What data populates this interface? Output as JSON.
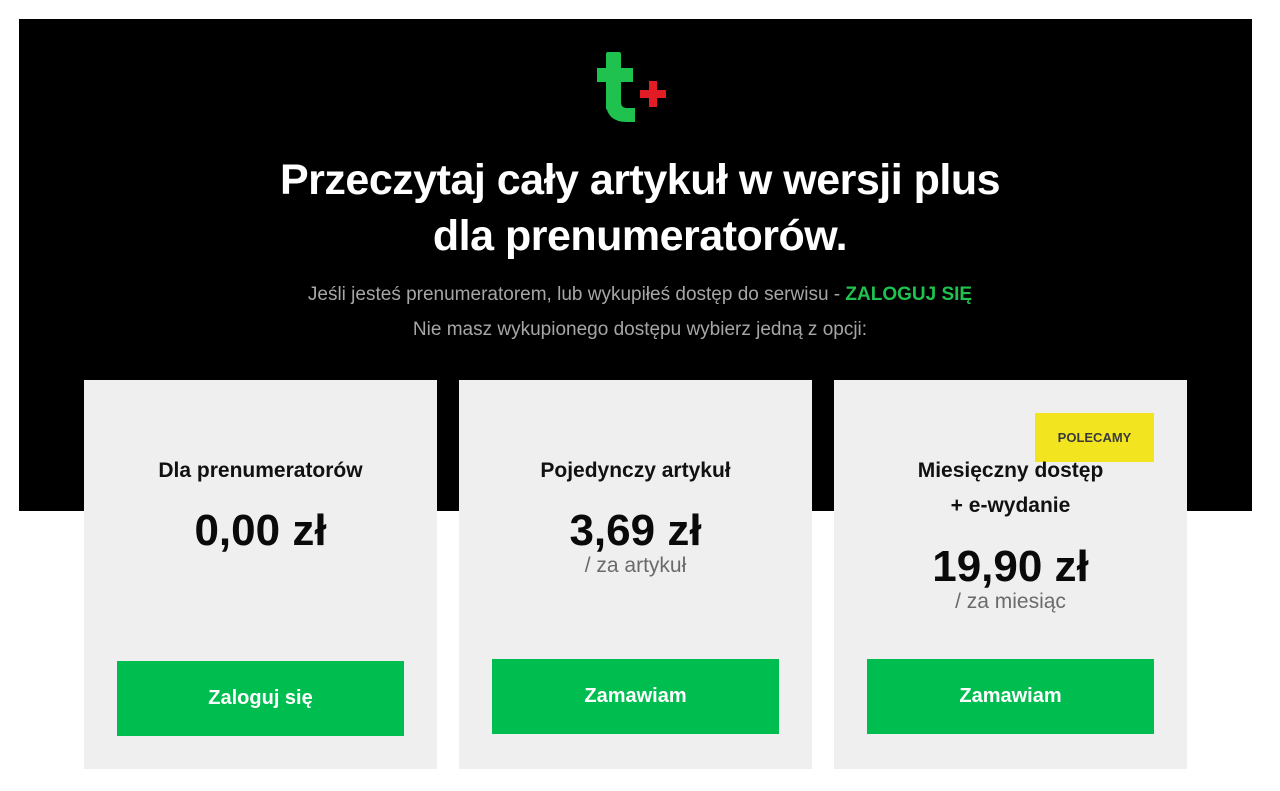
{
  "brand": {
    "logo_icon": "t-plus-logo-icon",
    "colors": {
      "letter": "#1fc24f",
      "plus": "#e11c24",
      "accent": "#00bd50",
      "badge": "#f2e51f",
      "hero_bg": "#000000"
    }
  },
  "header": {
    "headline_line1": "Przeczytaj cały artykuł w wersji plus",
    "headline_line2": "dla prenumeratorów.",
    "subscriber_text": "Jeśli jesteś prenumeratorem, lub wykupiłeś dostęp do serwisu - ",
    "login_link_label": "ZALOGUJ SIĘ",
    "choose_text": "Nie masz wykupionego dostępu wybierz jedną z opcji:"
  },
  "plans": [
    {
      "title": "Dla prenumeratorów",
      "price": "0,00 zł",
      "button": "Zaloguj się"
    },
    {
      "title": "Pojedynczy artykuł",
      "price": "3,69 zł",
      "period": "/ za artykuł",
      "button": "Zamawiam"
    },
    {
      "title_line1": "Miesięczny dostęp",
      "title_line2": "+ e-wydanie",
      "price": "19,90 zł",
      "period": "/ za miesiąc",
      "badge": "POLECAMY",
      "button": "Zamawiam"
    }
  ]
}
